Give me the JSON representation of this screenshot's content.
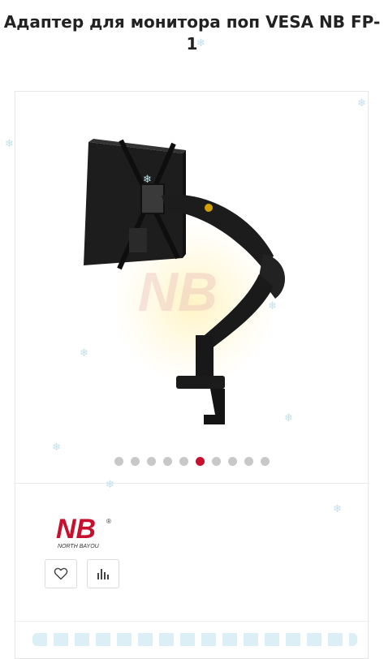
{
  "product": {
    "title": "Адаптер для монитора поп VESA NB FP-1"
  },
  "gallery": {
    "image_name": "monitor-arm-photo",
    "watermark": "NB",
    "dots_total": 10,
    "active_index": 5
  },
  "brand": {
    "logo_text": "NB",
    "logo_subtext": "NORTH BAYOU",
    "logo_color": "#c8102e"
  },
  "actions": {
    "wishlist_icon": "heart-icon",
    "compare_icon": "bar-chart-icon"
  },
  "colors": {
    "accent": "#c8102e",
    "dot_inactive": "#c8c8c8"
  }
}
